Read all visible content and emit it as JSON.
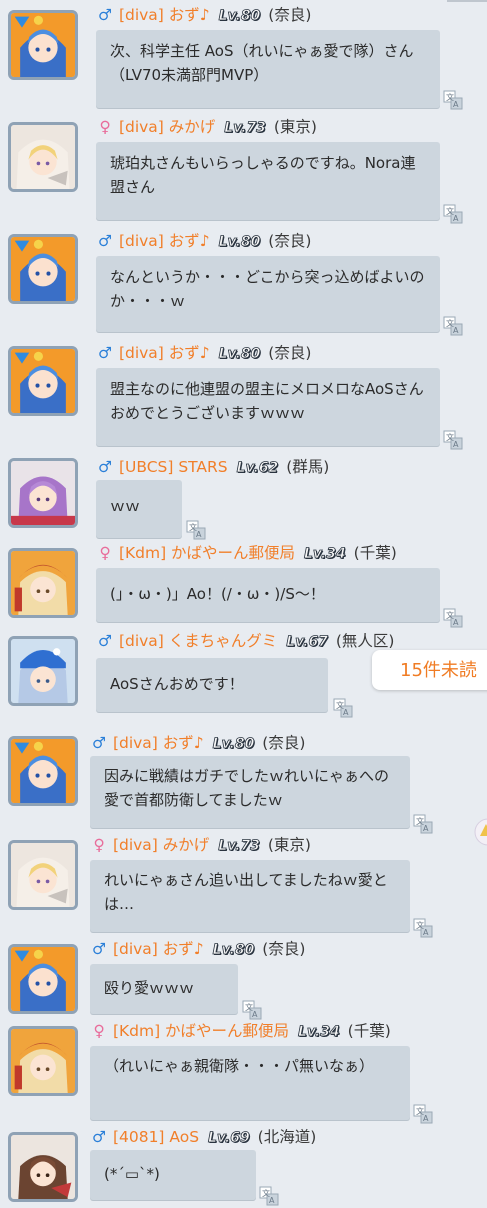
{
  "messages": [
    {
      "gender": "male",
      "name": "[diva] おず♪",
      "lv": "Lv.80",
      "pref": "(奈良)",
      "text": "次、科学主任 AoS（れいにゃぁ愛で隊）さん（LV70未満部門MVP）",
      "avatar": "blue-hair-girl"
    },
    {
      "gender": "female",
      "name": "[diva] みかげ",
      "lv": "Lv.73",
      "pref": "(東京)",
      "text": "琥珀丸さんもいらっしゃるのですね。Nora連盟さん",
      "avatar": "blonde-girl"
    },
    {
      "gender": "male",
      "name": "[diva] おず♪",
      "lv": "Lv.80",
      "pref": "(奈良)",
      "text": "なんというか・・・どこから突っ込めばよいのか・・・ｗ",
      "avatar": "blue-hair-girl"
    },
    {
      "gender": "male",
      "name": "[diva] おず♪",
      "lv": "Lv.80",
      "pref": "(奈良)",
      "text": "盟主なのに他連盟の盟主にメロメロなAoSさんおめでとうございますｗｗｗ",
      "avatar": "blue-hair-girl"
    },
    {
      "gender": "male",
      "name": "[UBCS] STARS",
      "lv": "Lv.62",
      "pref": "(群馬)",
      "text": "ｗｗ",
      "avatar": "purple-hair-girl"
    },
    {
      "gender": "female",
      "name": "[Kdm] かばやーん郵便局",
      "lv": "Lv.34",
      "pref": "(千葉)",
      "text": "(」・ω・)」Ao！(/・ω・)/S～！",
      "avatar": "hat-girl"
    },
    {
      "gender": "male",
      "name": "[diva] くまちゃんグミ",
      "lv": "Lv.67",
      "pref": "(無人区)",
      "text": "AoSさんおめです！",
      "avatar": "blue-hat-girl"
    },
    {
      "gender": "male",
      "name": "[diva] おず♪",
      "lv": "Lv.80",
      "pref": "(奈良)",
      "text": "因みに戦績はガチでしたｗれいにゃぁへの愛で首都防衛してましたｗ",
      "avatar": "blue-hair-girl"
    },
    {
      "gender": "female",
      "name": "[diva] みかげ",
      "lv": "Lv.73",
      "pref": "(東京)",
      "text": "れいにゃぁさん追い出してましたねｗ愛とは…",
      "avatar": "blonde-girl"
    },
    {
      "gender": "male",
      "name": "[diva] おず♪",
      "lv": "Lv.80",
      "pref": "(奈良)",
      "text": "殴り愛ｗｗｗ",
      "avatar": "blue-hair-girl"
    },
    {
      "gender": "female",
      "name": "[Kdm] かばやーん郵便局",
      "lv": "Lv.34",
      "pref": "(千葉)",
      "text": "（れいにゃぁ親衛隊・・・パ無いなぁ）",
      "avatar": "hat-girl"
    },
    {
      "gender": "male",
      "name": "[4081] AoS",
      "lv": "Lv.69",
      "pref": "(北海道)",
      "text": "(*´▭`*)",
      "avatar": "brown-hair-girl"
    }
  ],
  "unread_banner": "15件未読",
  "icons": {
    "male": "♂",
    "female": "♀",
    "translate": "translate-icon"
  },
  "colors": {
    "name": "#f17f2a",
    "bubble": "#cdd6de",
    "background": "#e8ecf1",
    "male": "#2a7fd8",
    "female": "#e86d9b"
  }
}
